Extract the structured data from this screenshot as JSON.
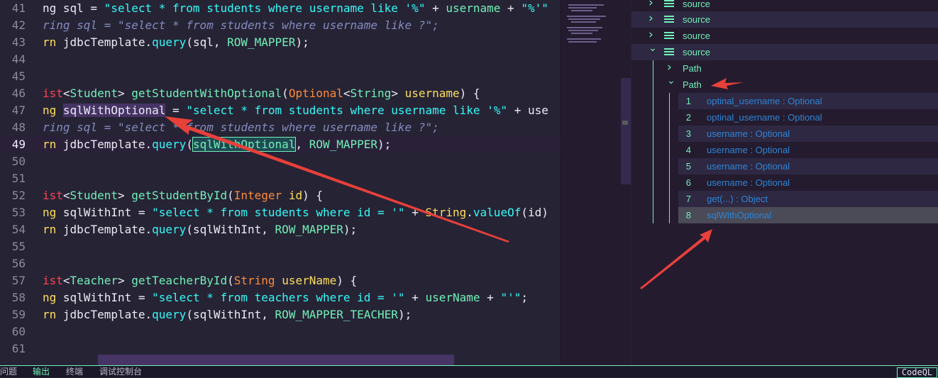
{
  "editor": {
    "lines": [
      {
        "num": "41",
        "tokens": [
          {
            "t": "ng sql = ",
            "c": "plain"
          },
          {
            "t": "\"select * from students where username like '%\"",
            "c": "str2"
          },
          {
            "t": " + ",
            "c": "plain"
          },
          {
            "t": "username",
            "c": "teal"
          },
          {
            "t": " + ",
            "c": "plain"
          },
          {
            "t": "\"%'\"",
            "c": "str2"
          }
        ]
      },
      {
        "num": "42",
        "tokens": [
          {
            "t": "ring sql = \"select * from students where username like ?\";",
            "c": "cmt"
          }
        ]
      },
      {
        "num": "43",
        "tokens": [
          {
            "t": "rn ",
            "c": "kw"
          },
          {
            "t": "jdbcTemplate",
            "c": "plain"
          },
          {
            "t": ".",
            "c": "plain"
          },
          {
            "t": "query",
            "c": "fn"
          },
          {
            "t": "(sql, ",
            "c": "plain"
          },
          {
            "t": "ROW_MAPPER",
            "c": "teal"
          },
          {
            "t": ");",
            "c": "plain"
          }
        ]
      },
      {
        "num": "44",
        "tokens": []
      },
      {
        "num": "45",
        "tokens": []
      },
      {
        "num": "46",
        "tokens": [
          {
            "t": "ist",
            "c": "type"
          },
          {
            "t": "<",
            "c": "plain"
          },
          {
            "t": "Student",
            "c": "teal"
          },
          {
            "t": "> ",
            "c": "plain"
          },
          {
            "t": "getStudentWithOptional",
            "c": "teal"
          },
          {
            "t": "(",
            "c": "plain"
          },
          {
            "t": "Optional",
            "c": "orange"
          },
          {
            "t": "<",
            "c": "plain"
          },
          {
            "t": "String",
            "c": "teal"
          },
          {
            "t": "> ",
            "c": "plain"
          },
          {
            "t": "username",
            "c": "yellow"
          },
          {
            "t": ") {",
            "c": "plain"
          }
        ]
      },
      {
        "num": "47",
        "tokens": [
          {
            "t": "ng ",
            "c": "kw"
          },
          {
            "t": "sqlWithOptional",
            "c": "sel"
          },
          {
            "t": " = ",
            "c": "plain"
          },
          {
            "t": "\"select * from students where username like '%\"",
            "c": "str2"
          },
          {
            "t": " + use",
            "c": "plain"
          }
        ]
      },
      {
        "num": "48",
        "tokens": [
          {
            "t": "ring sql = \"select * from students where username like ?\";",
            "c": "cmt"
          }
        ]
      },
      {
        "num": "49",
        "current": true,
        "tokens": [
          {
            "t": "rn ",
            "c": "kw"
          },
          {
            "t": "jdbcTemplate",
            "c": "plain"
          },
          {
            "t": ".",
            "c": "plain"
          },
          {
            "t": "query",
            "c": "fn"
          },
          {
            "t": "(",
            "c": "plain"
          },
          {
            "t": "sqlWithOptional",
            "c": "hl"
          },
          {
            "t": ", ",
            "c": "plain"
          },
          {
            "t": "ROW_MAPPER",
            "c": "teal"
          },
          {
            "t": ");",
            "c": "plain"
          }
        ]
      },
      {
        "num": "50",
        "tokens": []
      },
      {
        "num": "51",
        "tokens": []
      },
      {
        "num": "52",
        "tokens": [
          {
            "t": "ist",
            "c": "type"
          },
          {
            "t": "<",
            "c": "plain"
          },
          {
            "t": "Student",
            "c": "teal"
          },
          {
            "t": "> ",
            "c": "plain"
          },
          {
            "t": "getStudentById",
            "c": "teal"
          },
          {
            "t": "(",
            "c": "plain"
          },
          {
            "t": "Integer",
            "c": "orange"
          },
          {
            "t": " ",
            "c": "plain"
          },
          {
            "t": "id",
            "c": "yellow"
          },
          {
            "t": ") {",
            "c": "plain"
          }
        ]
      },
      {
        "num": "53",
        "tokens": [
          {
            "t": "ng ",
            "c": "kw"
          },
          {
            "t": "sqlWithInt = ",
            "c": "plain"
          },
          {
            "t": "\"select * from students where id = '\"",
            "c": "str2"
          },
          {
            "t": " + ",
            "c": "plain"
          },
          {
            "t": "String",
            "c": "yellow"
          },
          {
            "t": ".",
            "c": "plain"
          },
          {
            "t": "valueOf",
            "c": "fn"
          },
          {
            "t": "(id)",
            "c": "plain"
          }
        ]
      },
      {
        "num": "54",
        "tokens": [
          {
            "t": "rn ",
            "c": "kw"
          },
          {
            "t": "jdbcTemplate",
            "c": "plain"
          },
          {
            "t": ".",
            "c": "plain"
          },
          {
            "t": "query",
            "c": "fn"
          },
          {
            "t": "(sqlWithInt, ",
            "c": "plain"
          },
          {
            "t": "ROW_MAPPER",
            "c": "teal"
          },
          {
            "t": ");",
            "c": "plain"
          }
        ]
      },
      {
        "num": "55",
        "tokens": []
      },
      {
        "num": "56",
        "tokens": []
      },
      {
        "num": "57",
        "tokens": [
          {
            "t": "ist",
            "c": "type"
          },
          {
            "t": "<",
            "c": "plain"
          },
          {
            "t": "Teacher",
            "c": "teal"
          },
          {
            "t": "> ",
            "c": "plain"
          },
          {
            "t": "getTeacherById",
            "c": "teal"
          },
          {
            "t": "(",
            "c": "plain"
          },
          {
            "t": "String",
            "c": "orange"
          },
          {
            "t": " ",
            "c": "plain"
          },
          {
            "t": "userName",
            "c": "yellow"
          },
          {
            "t": ") {",
            "c": "plain"
          }
        ]
      },
      {
        "num": "58",
        "tokens": [
          {
            "t": "ng ",
            "c": "kw"
          },
          {
            "t": "sqlWithInt = ",
            "c": "plain"
          },
          {
            "t": "\"select * from teachers where id = '\"",
            "c": "str2"
          },
          {
            "t": " + ",
            "c": "plain"
          },
          {
            "t": "userName",
            "c": "teal"
          },
          {
            "t": " + ",
            "c": "plain"
          },
          {
            "t": "\"'\"",
            "c": "str2"
          },
          {
            "t": ";",
            "c": "plain"
          }
        ]
      },
      {
        "num": "59",
        "tokens": [
          {
            "t": "rn ",
            "c": "kw"
          },
          {
            "t": "jdbcTemplate",
            "c": "plain"
          },
          {
            "t": ".",
            "c": "plain"
          },
          {
            "t": "query",
            "c": "fn"
          },
          {
            "t": "(sqlWithInt, ",
            "c": "plain"
          },
          {
            "t": "ROW_MAPPER_TEACHER",
            "c": "teal"
          },
          {
            "t": ");",
            "c": "plain"
          }
        ]
      },
      {
        "num": "60",
        "tokens": []
      },
      {
        "num": "61",
        "tokens": []
      }
    ]
  },
  "panel": {
    "sources": [
      {
        "label": "source",
        "expanded": false
      },
      {
        "label": "source",
        "expanded": false
      },
      {
        "label": "source",
        "expanded": false
      },
      {
        "label": "source",
        "expanded": true
      }
    ],
    "paths": [
      {
        "label": "Path",
        "expanded": false
      },
      {
        "label": "Path",
        "expanded": true
      }
    ],
    "items": [
      {
        "num": "1",
        "text": "optinal_username : Optional"
      },
      {
        "num": "2",
        "text": "optinal_username : Optional"
      },
      {
        "num": "3",
        "text": "username : Optional"
      },
      {
        "num": "4",
        "text": "username : Optional"
      },
      {
        "num": "5",
        "text": "username : Optional"
      },
      {
        "num": "6",
        "text": "username : Optional"
      },
      {
        "num": "7",
        "text": "get(...) : Object"
      },
      {
        "num": "8",
        "text": "sqlWithOptional",
        "selected": true
      }
    ]
  },
  "bottombar": {
    "tabs": [
      "问题",
      "输出",
      "终端",
      "调试控制台"
    ],
    "active_index": 1,
    "codeql_label": "CodeQL"
  },
  "colors": {
    "accent": "#72f1b8",
    "arrow": "#e8403a"
  }
}
